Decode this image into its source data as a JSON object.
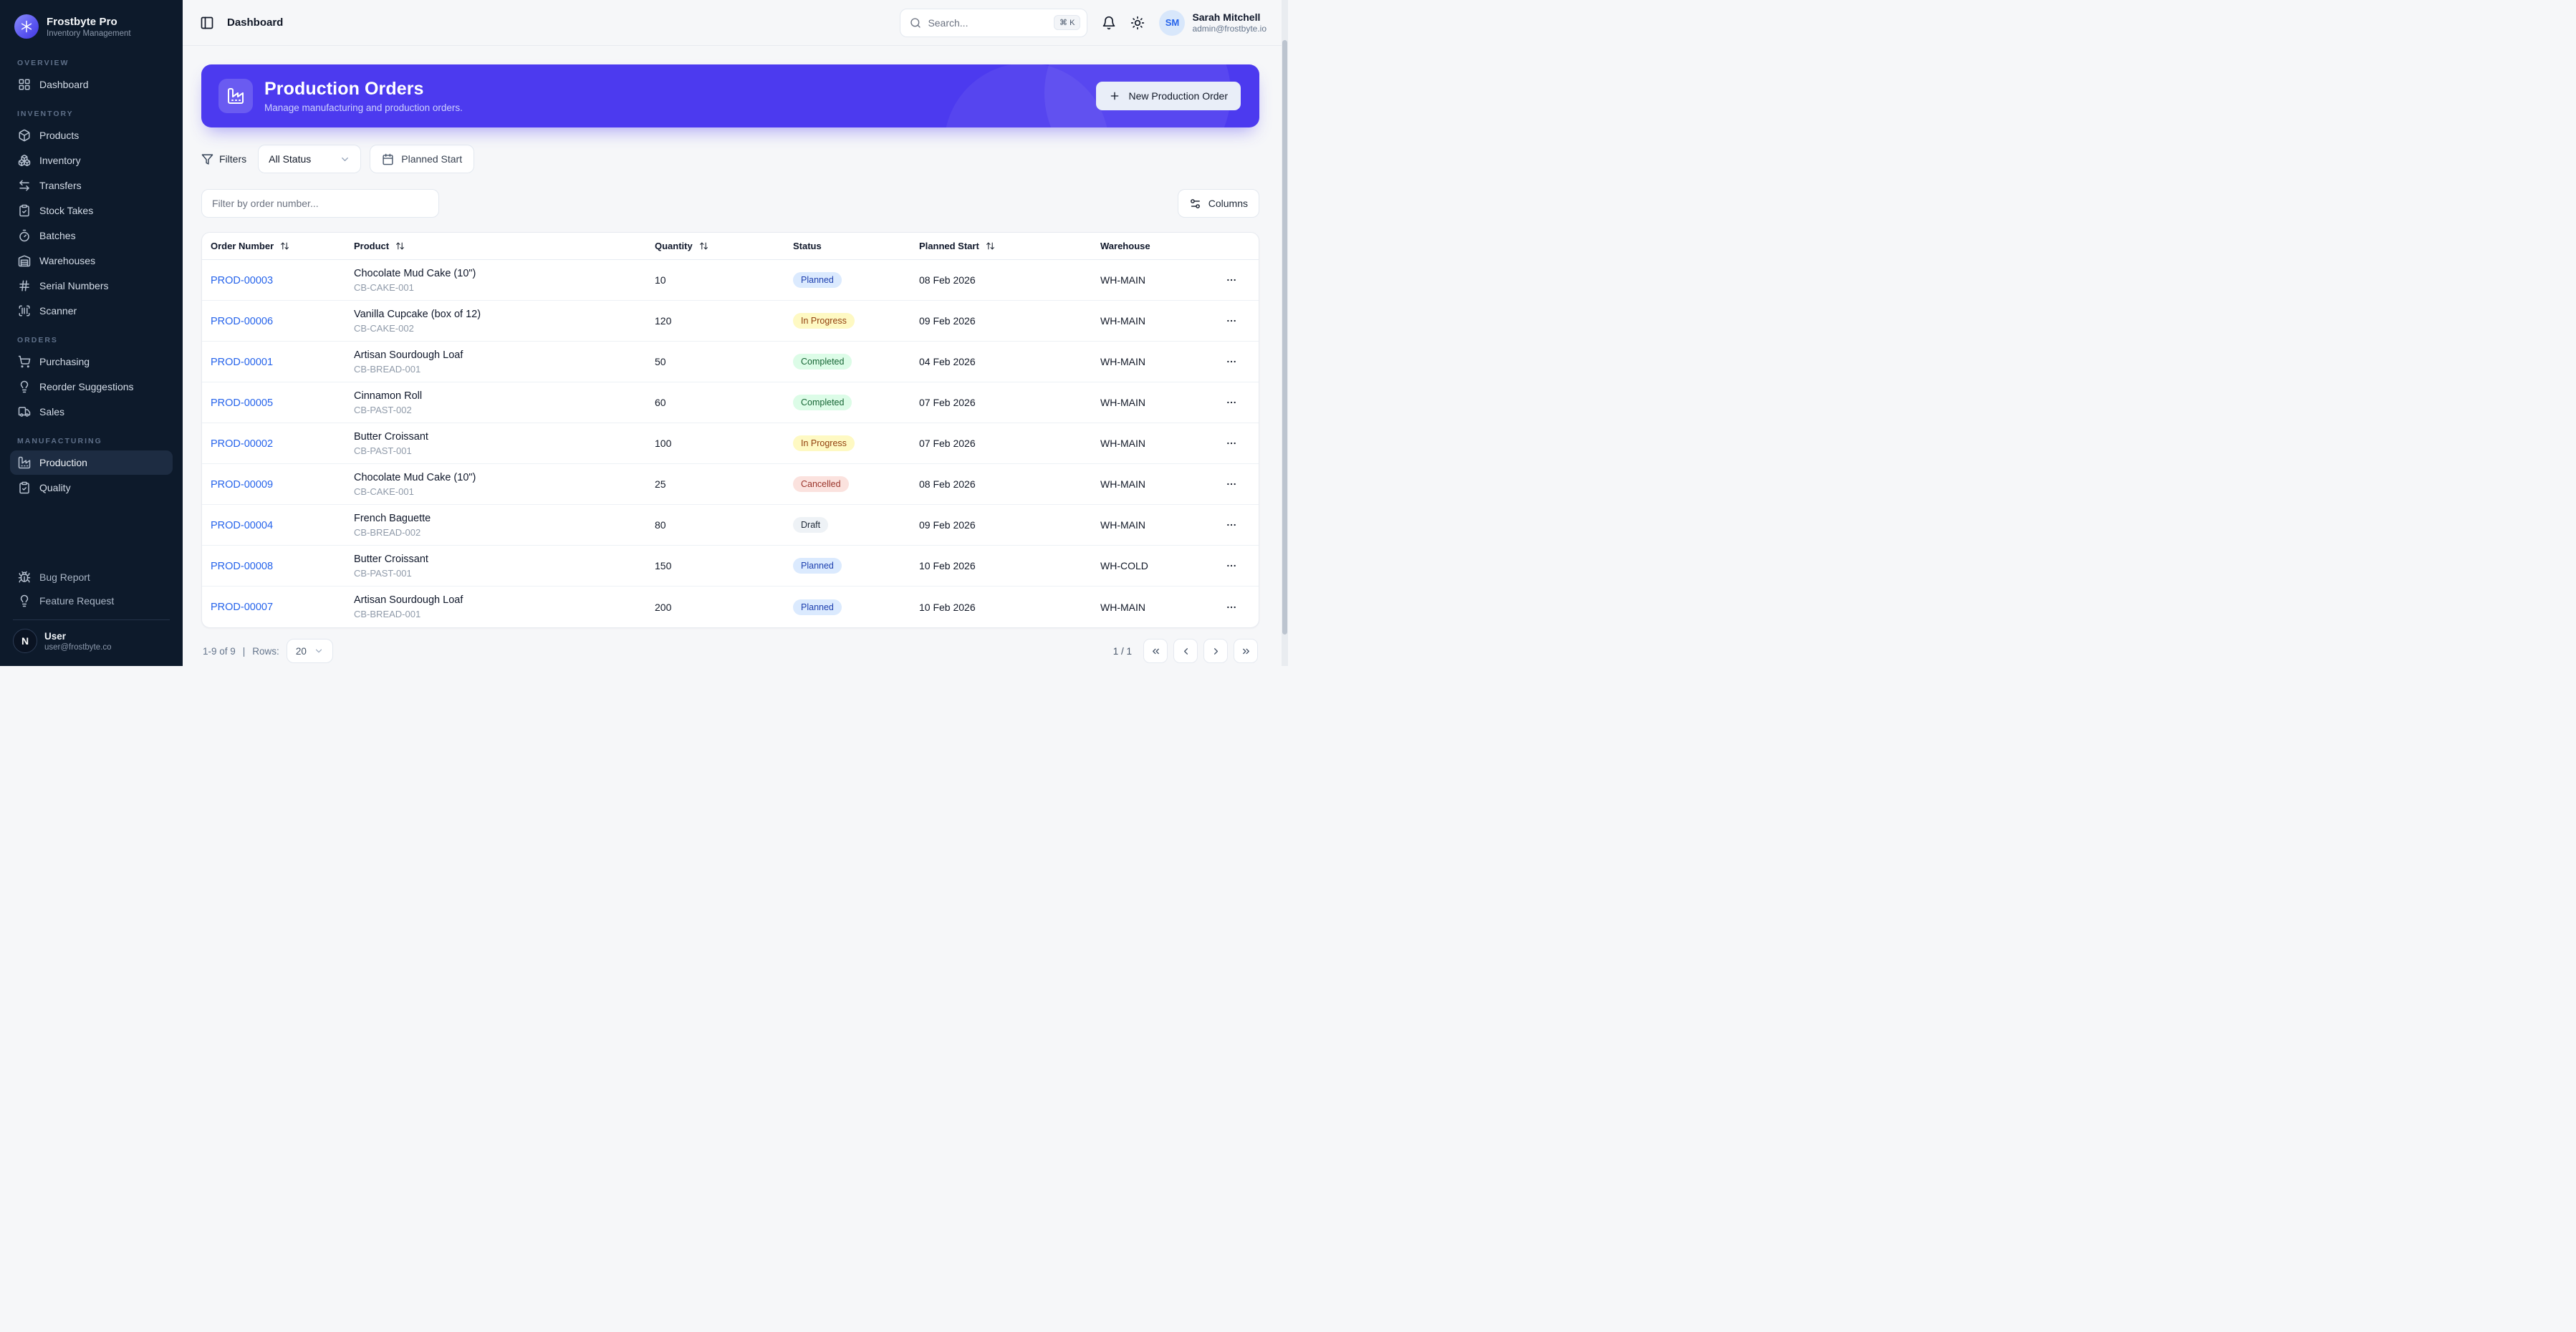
{
  "colors": {
    "sidebar_bg": "#0d1a2b",
    "banner_accent": "#4c3aef",
    "link_blue": "#2563eb",
    "badge_planned_bg": "#dbeafe",
    "badge_planned_text": "#1e40af",
    "badge_inprogress_bg": "#fef9c3",
    "badge_inprogress_text": "#92400e",
    "badge_completed_bg": "#dcfce7",
    "badge_completed_text": "#166534",
    "badge_cancelled_bg": "#fbe2de",
    "badge_cancelled_text": "#9a342a",
    "badge_draft_bg": "#eef2f6",
    "badge_draft_text": "#1f2937"
  },
  "sidebar": {
    "brand": {
      "name": "Frostbyte Pro",
      "subtitle": "Inventory Management"
    },
    "section_overview": {
      "label": "OVERVIEW",
      "items": [
        {
          "label": "Dashboard",
          "icon": "dashboard-icon"
        }
      ]
    },
    "section_inventory": {
      "label": "INVENTORY",
      "items": [
        {
          "label": "Products",
          "icon": "package-icon"
        },
        {
          "label": "Inventory",
          "icon": "boxes-icon"
        },
        {
          "label": "Transfers",
          "icon": "transfers-icon"
        },
        {
          "label": "Stock Takes",
          "icon": "clipboard-check-icon"
        },
        {
          "label": "Batches",
          "icon": "timer-icon"
        },
        {
          "label": "Warehouses",
          "icon": "warehouse-icon"
        },
        {
          "label": "Serial Numbers",
          "icon": "hash-icon"
        },
        {
          "label": "Scanner",
          "icon": "scan-barcode-icon"
        }
      ]
    },
    "section_orders": {
      "label": "ORDERS",
      "items": [
        {
          "label": "Purchasing",
          "icon": "cart-icon"
        },
        {
          "label": "Reorder Suggestions",
          "icon": "lightbulb-icon"
        },
        {
          "label": "Sales",
          "icon": "truck-icon"
        }
      ]
    },
    "section_manufacturing": {
      "label": "MANUFACTURING",
      "items": [
        {
          "label": "Production",
          "icon": "factory-icon",
          "active": true
        },
        {
          "label": "Quality",
          "icon": "clipboard-check-icon"
        }
      ]
    },
    "footer_items": [
      {
        "label": "Bug Report",
        "icon": "bug-icon"
      },
      {
        "label": "Feature Request",
        "icon": "lightbulb-icon"
      }
    ],
    "user": {
      "name": "User",
      "email": "user@frostbyte.co",
      "avatar_initial": "N"
    }
  },
  "topbar": {
    "title": "Dashboard",
    "search_placeholder": "Search...",
    "search_shortcut": "⌘ K",
    "user": {
      "name": "Sarah Mitchell",
      "email": "admin@frostbyte.io",
      "initials": "SM"
    }
  },
  "banner": {
    "title": "Production Orders",
    "subtitle": "Manage manufacturing and production orders.",
    "button_label": "New Production Order"
  },
  "filters": {
    "label": "Filters",
    "status_select_value": "All Status",
    "date_button_label": "Planned Start"
  },
  "table_toolbar": {
    "filter_placeholder": "Filter by order number...",
    "columns_button_label": "Columns"
  },
  "table": {
    "columns": [
      {
        "label": "Order Number"
      },
      {
        "label": "Product"
      },
      {
        "label": "Quantity"
      },
      {
        "label": "Status"
      },
      {
        "label": "Planned Start"
      },
      {
        "label": "Warehouse"
      },
      {
        "label": ""
      }
    ],
    "rows": [
      {
        "order": "PROD-00003",
        "product": "Chocolate Mud Cake (10\")",
        "sku": "CB-CAKE-001",
        "quantity": "10",
        "status": "Planned",
        "status_key": "planned",
        "planned_start": "08 Feb 2026",
        "warehouse": "WH-MAIN"
      },
      {
        "order": "PROD-00006",
        "product": "Vanilla Cupcake (box of 12)",
        "sku": "CB-CAKE-002",
        "quantity": "120",
        "status": "In Progress",
        "status_key": "inprogress",
        "planned_start": "09 Feb 2026",
        "warehouse": "WH-MAIN"
      },
      {
        "order": "PROD-00001",
        "product": "Artisan Sourdough Loaf",
        "sku": "CB-BREAD-001",
        "quantity": "50",
        "status": "Completed",
        "status_key": "completed",
        "planned_start": "04 Feb 2026",
        "warehouse": "WH-MAIN"
      },
      {
        "order": "PROD-00005",
        "product": "Cinnamon Roll",
        "sku": "CB-PAST-002",
        "quantity": "60",
        "status": "Completed",
        "status_key": "completed",
        "planned_start": "07 Feb 2026",
        "warehouse": "WH-MAIN"
      },
      {
        "order": "PROD-00002",
        "product": "Butter Croissant",
        "sku": "CB-PAST-001",
        "quantity": "100",
        "status": "In Progress",
        "status_key": "inprogress",
        "planned_start": "07 Feb 2026",
        "warehouse": "WH-MAIN"
      },
      {
        "order": "PROD-00009",
        "product": "Chocolate Mud Cake (10\")",
        "sku": "CB-CAKE-001",
        "quantity": "25",
        "status": "Cancelled",
        "status_key": "cancelled",
        "planned_start": "08 Feb 2026",
        "warehouse": "WH-MAIN"
      },
      {
        "order": "PROD-00004",
        "product": "French Baguette",
        "sku": "CB-BREAD-002",
        "quantity": "80",
        "status": "Draft",
        "status_key": "draft",
        "planned_start": "09 Feb 2026",
        "warehouse": "WH-MAIN"
      },
      {
        "order": "PROD-00008",
        "product": "Butter Croissant",
        "sku": "CB-PAST-001",
        "quantity": "150",
        "status": "Planned",
        "status_key": "planned",
        "planned_start": "10 Feb 2026",
        "warehouse": "WH-COLD"
      },
      {
        "order": "PROD-00007",
        "product": "Artisan Sourdough Loaf",
        "sku": "CB-BREAD-001",
        "quantity": "200",
        "status": "Planned",
        "status_key": "planned",
        "planned_start": "10 Feb 2026",
        "warehouse": "WH-MAIN"
      }
    ]
  },
  "pagination": {
    "summary": "1-9 of 9",
    "divider": "|",
    "rows_label": "Rows:",
    "rows_per_page": "20",
    "page_indicator": "1 / 1"
  }
}
